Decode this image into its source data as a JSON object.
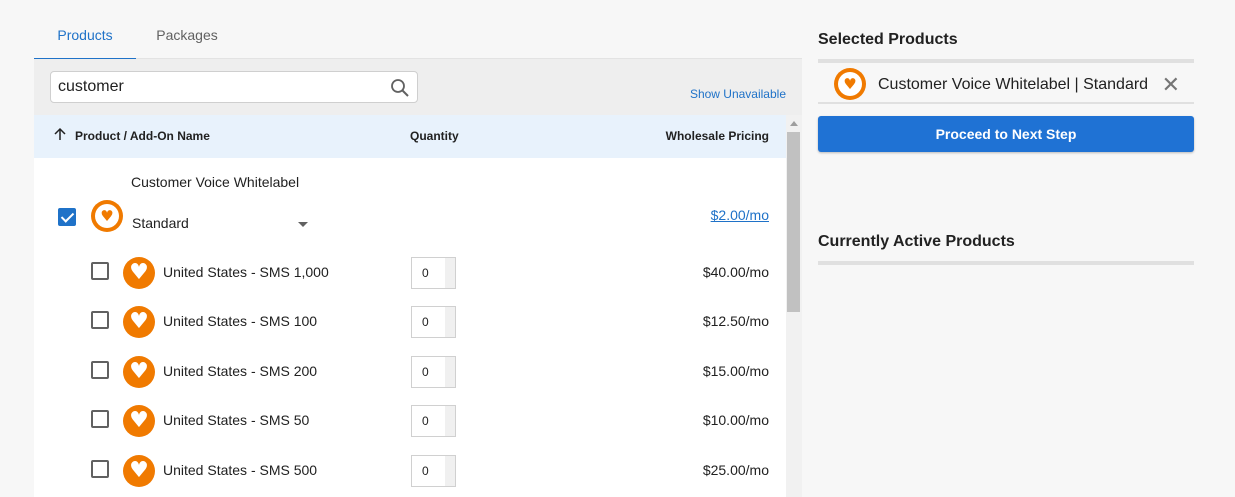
{
  "tabs": [
    {
      "label": "Products",
      "active": true
    },
    {
      "label": "Packages",
      "active": false
    }
  ],
  "search": {
    "value": "customer",
    "show_unavailable_label": "Show Unavailable"
  },
  "table": {
    "headers": {
      "name": "Product / Add-On Name",
      "quantity": "Quantity",
      "pricing": "Wholesale Pricing"
    },
    "main_product": {
      "name": "Customer Voice Whitelabel",
      "edition": "Standard",
      "price": "$2.00/mo",
      "checked": true
    },
    "addons": [
      {
        "name": "United States - SMS 1,000",
        "quantity": "0",
        "price": "$40.00/mo",
        "checked": false
      },
      {
        "name": "United States - SMS 100",
        "quantity": "0",
        "price": "$12.50/mo",
        "checked": false
      },
      {
        "name": "United States - SMS 200",
        "quantity": "0",
        "price": "$15.00/mo",
        "checked": false
      },
      {
        "name": "United States - SMS 50",
        "quantity": "0",
        "price": "$10.00/mo",
        "checked": false
      },
      {
        "name": "United States - SMS 500",
        "quantity": "0",
        "price": "$25.00/mo",
        "checked": false
      }
    ]
  },
  "selected_panel": {
    "title": "Selected Products",
    "item_label": "Customer Voice Whitelabel | Standard",
    "proceed_label": "Proceed to Next Step"
  },
  "active_panel": {
    "title": "Currently Active Products"
  },
  "colors": {
    "accent": "#1f72c8",
    "brand_orange": "#f07a00",
    "header_bg": "#e8f2fc"
  }
}
